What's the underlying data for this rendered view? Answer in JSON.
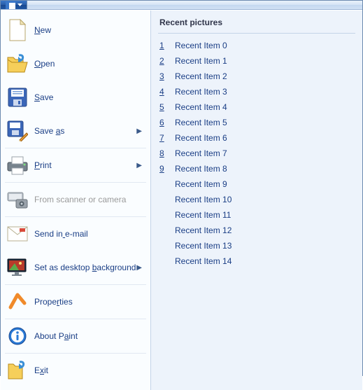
{
  "menu": {
    "items": [
      {
        "id": "new",
        "label": "New",
        "underline_index": 0,
        "has_submenu": false,
        "disabled": false,
        "sep_after": false
      },
      {
        "id": "open",
        "label": "Open",
        "underline_index": 0,
        "has_submenu": false,
        "disabled": false,
        "sep_after": false
      },
      {
        "id": "save",
        "label": "Save",
        "underline_index": 0,
        "has_submenu": false,
        "disabled": false,
        "sep_after": false
      },
      {
        "id": "saveas",
        "label": "Save as",
        "underline_index": 5,
        "has_submenu": true,
        "disabled": false,
        "sep_after": true
      },
      {
        "id": "print",
        "label": "Print",
        "underline_index": 0,
        "has_submenu": true,
        "disabled": false,
        "sep_after": true
      },
      {
        "id": "scanner",
        "label": "From scanner or camera",
        "underline_index": -1,
        "has_submenu": false,
        "disabled": true,
        "sep_after": true
      },
      {
        "id": "email",
        "label": "Send in e-mail",
        "underline_index": 7,
        "has_submenu": false,
        "disabled": false,
        "sep_after": false
      },
      {
        "id": "wallpaper",
        "label": "Set as desktop background",
        "underline_index": 15,
        "has_submenu": true,
        "disabled": false,
        "sep_after": true
      },
      {
        "id": "properties",
        "label": "Properties",
        "underline_index": 5,
        "has_submenu": false,
        "disabled": false,
        "sep_after": true
      },
      {
        "id": "about",
        "label": "About Paint",
        "underline_index": 7,
        "has_submenu": false,
        "disabled": false,
        "sep_after": true
      },
      {
        "id": "exit",
        "label": "Exit",
        "underline_index": 1,
        "has_submenu": false,
        "disabled": false,
        "sep_after": false
      }
    ]
  },
  "recent": {
    "header": "Recent pictures",
    "items": [
      {
        "num": "1",
        "label": "Recent Item 0"
      },
      {
        "num": "2",
        "label": "Recent Item 1"
      },
      {
        "num": "3",
        "label": "Recent Item 2"
      },
      {
        "num": "4",
        "label": "Recent Item 3"
      },
      {
        "num": "5",
        "label": "Recent Item 4"
      },
      {
        "num": "6",
        "label": "Recent Item 5"
      },
      {
        "num": "7",
        "label": "Recent Item 6"
      },
      {
        "num": "8",
        "label": "Recent Item 7"
      },
      {
        "num": "9",
        "label": "Recent Item 8"
      },
      {
        "num": "",
        "label": "Recent Item 9"
      },
      {
        "num": "",
        "label": "Recent Item 10"
      },
      {
        "num": "",
        "label": "Recent Item 11"
      },
      {
        "num": "",
        "label": "Recent Item 12"
      },
      {
        "num": "",
        "label": "Recent Item 13"
      },
      {
        "num": "",
        "label": "Recent Item 14"
      }
    ]
  }
}
